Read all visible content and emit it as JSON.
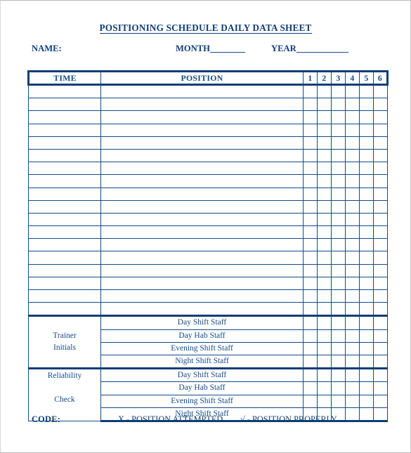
{
  "document": {
    "title": "POSITIONING SCHEDULE DAILY DATA SHEET",
    "fields": {
      "name_label": "NAME:",
      "month_label": "MONTH",
      "year_label": "YEAR"
    },
    "table": {
      "headers": {
        "time": "TIME",
        "position": "POSITION",
        "numbers": [
          "1",
          "2",
          "3",
          "4",
          "5",
          "6"
        ]
      },
      "empty_row_count": 18,
      "footer_groups": [
        {
          "label": "Trainer\nInitials",
          "rows": [
            "Day Shift Staff",
            "Day Hab Staff",
            "Evening Shift Staff",
            "Night Shift Staff"
          ]
        },
        {
          "label": "Reliability\n\nCheck",
          "rows": [
            "Day Shift Staff",
            "Day Hab Staff",
            "Evening Shift Staff",
            "Night Shift Staff"
          ]
        }
      ]
    },
    "code_legend": {
      "label": "CODE:",
      "attempted": "X  - POSITION ATTEMPTED",
      "properly": "√ - POSITION PROPERLY"
    },
    "colors": {
      "ink": "#0e3d77",
      "rule": "#124a87",
      "page": "#ffffff"
    }
  }
}
